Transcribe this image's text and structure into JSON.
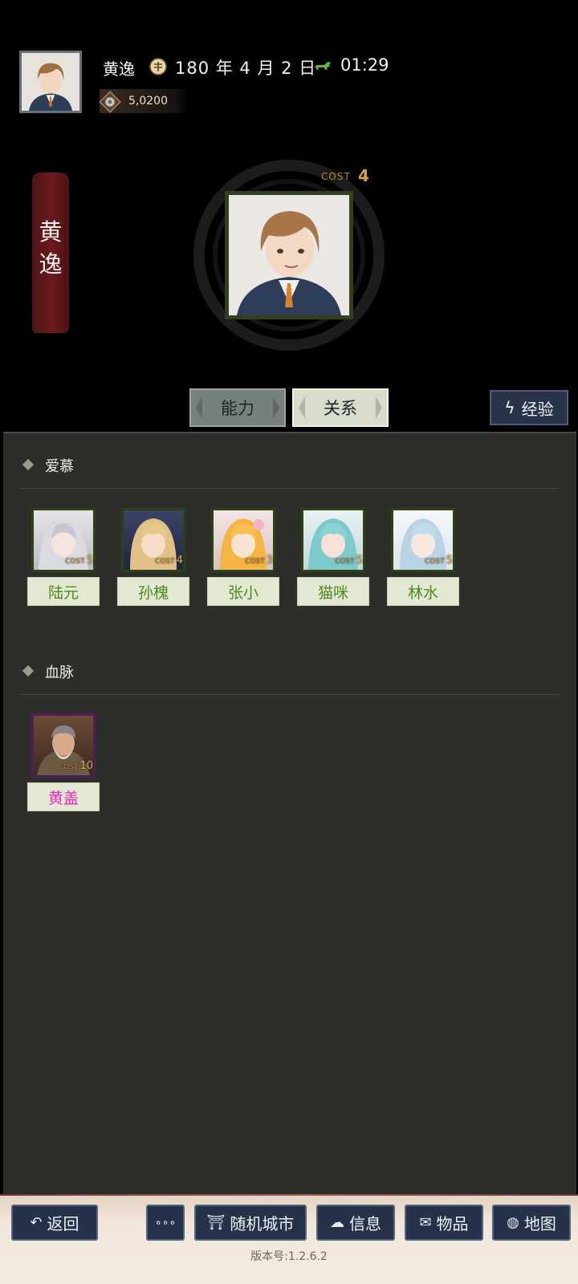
{
  "status": {
    "player_name": "黄逸",
    "date": "180 年 4 月 2 日",
    "time": "01:29",
    "coins": "5,0200"
  },
  "banner": {
    "name_char_1": "黄",
    "name_char_2": "逸"
  },
  "portrait": {
    "cost_label": "COST",
    "cost_value": "4"
  },
  "tabs": {
    "ability": "能力",
    "relation": "关系",
    "experience": "经验"
  },
  "sections": {
    "admire": {
      "title": "爱慕",
      "characters": [
        {
          "name": "陆元",
          "cost": "5"
        },
        {
          "name": "孙槐",
          "cost": "4"
        },
        {
          "name": "张小",
          "cost": "3"
        },
        {
          "name": "猫咪",
          "cost": "5"
        },
        {
          "name": "林水",
          "cost": "5"
        }
      ]
    },
    "bloodline": {
      "title": "血脉",
      "characters": [
        {
          "name": "黄盖",
          "cost": "10"
        }
      ]
    }
  },
  "bottom_nav": {
    "back": "返回",
    "more": "∘∘∘",
    "random_city": "随机城市",
    "info": "信息",
    "items": "物品",
    "map": "地图"
  },
  "version": "版本号:1.2.6.2",
  "colors": {
    "bg": "#000000",
    "panel": "#2d2d29",
    "name_green": "#4e8a1f",
    "name_magenta": "#e526c2",
    "cost_gold": "#d8a43a",
    "button_navy": "#25324a"
  }
}
